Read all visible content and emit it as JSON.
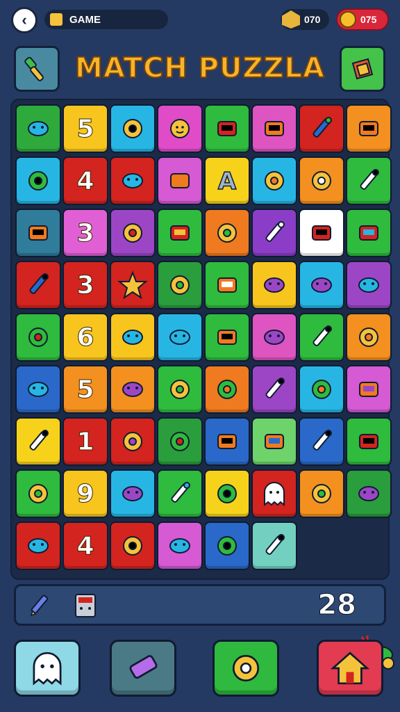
{
  "topbar": {
    "back_icon": "chevron-left-icon",
    "game_label": "GAME",
    "coins": "070",
    "lives": "075"
  },
  "title": "MATCH PUZZLA",
  "board": {
    "rows": 9,
    "cols": 8,
    "tiles": [
      {
        "color": "#2eaa3c",
        "icon": "creature-icon"
      },
      {
        "color": "#f7c51d",
        "num": "5"
      },
      {
        "color": "#27b6e4",
        "icon": "device-icon"
      },
      {
        "color": "#e04bc8",
        "icon": "sun-face-icon"
      },
      {
        "color": "#2fbb3d",
        "icon": "pencil-icon"
      },
      {
        "color": "#de55c2",
        "icon": "bird-icon"
      },
      {
        "color": "#d3241f",
        "icon": "gears-icon"
      },
      {
        "color": "#f3901f",
        "icon": "target-icon"
      },
      {
        "color": "#27b6e4",
        "icon": "robot-icon"
      },
      {
        "color": "#d3241f",
        "num": "4"
      },
      {
        "color": "#d3241f",
        "icon": "crown-icon"
      },
      {
        "color": "#d55ad3",
        "icon": "pen-icon"
      },
      {
        "color": "#f7d21b",
        "icon": "letter-a-icon"
      },
      {
        "color": "#27b6e4",
        "icon": "magnifier-icon"
      },
      {
        "color": "#f3901f",
        "icon": "gear-icon"
      },
      {
        "color": "#2fbb3d",
        "icon": "search-icon"
      },
      {
        "color": "#2f7d9b",
        "icon": "shield-icon"
      },
      {
        "color": "#e15fd4",
        "num": "3"
      },
      {
        "color": "#9c46c6",
        "icon": "leaf-icon"
      },
      {
        "color": "#2fbb3d",
        "icon": "egg-icon"
      },
      {
        "color": "#f07a1f",
        "icon": "crayon-icon"
      },
      {
        "color": "#8b3dc8",
        "icon": "ring-icon"
      },
      {
        "color": "#ffffff",
        "icon": "pencil-icon"
      },
      {
        "color": "#2fbb3d",
        "icon": "trowel-icon"
      },
      {
        "color": "#d3241f",
        "icon": "heart-badge-icon"
      },
      {
        "color": "#d3241f",
        "num": "3"
      },
      {
        "color": "#d3241f",
        "icon": "star-icon"
      },
      {
        "color": "#2a9d3c",
        "icon": "bottle-icon"
      },
      {
        "color": "#2fbb3d",
        "icon": "spoon-icon"
      },
      {
        "color": "#f7c51d",
        "icon": "bell-icon"
      },
      {
        "color": "#27b6e4",
        "icon": "toolbox-icon"
      },
      {
        "color": "#9c46c6",
        "icon": "cherries-icon"
      },
      {
        "color": "#2fbb3d",
        "icon": "monitor-icon"
      },
      {
        "color": "#f7c51d",
        "num": "6"
      },
      {
        "color": "#f7c51d",
        "icon": "cheese-icon"
      },
      {
        "color": "#27b6e4",
        "icon": "balloon-icon"
      },
      {
        "color": "#2fbb3d",
        "icon": "germ-icon"
      },
      {
        "color": "#de55c2",
        "icon": "sheep-icon"
      },
      {
        "color": "#2fbb3d",
        "icon": "planet-icon"
      },
      {
        "color": "#f3901f",
        "icon": "lens-icon"
      },
      {
        "color": "#2a69c9",
        "icon": "key-icon"
      },
      {
        "color": "#f3901f",
        "num": "5"
      },
      {
        "color": "#f3901f",
        "icon": "box-icon"
      },
      {
        "color": "#2fbb3d",
        "icon": "hammer-icon"
      },
      {
        "color": "#f07a1f",
        "icon": "brush-icon"
      },
      {
        "color": "#9c46c6",
        "icon": "ladle-icon"
      },
      {
        "color": "#27b6e4",
        "icon": "marker-icon"
      },
      {
        "color": "#d55ad3",
        "icon": "wrench-icon"
      },
      {
        "color": "#f7d21b",
        "icon": "card-icon"
      },
      {
        "color": "#d3241f",
        "num": "1"
      },
      {
        "color": "#d3241f",
        "icon": "cross-tools-icon"
      },
      {
        "color": "#2a9d3c",
        "icon": "pickle-icon"
      },
      {
        "color": "#2a69c9",
        "icon": "spiral-icon"
      },
      {
        "color": "#6dd36a",
        "icon": "smile-bubble-icon"
      },
      {
        "color": "#2a69c9",
        "icon": "castle-icon"
      },
      {
        "color": "#2fbb3d",
        "icon": "virus-icon"
      },
      {
        "color": "#2fbb3d",
        "icon": "hammer-icon"
      },
      {
        "color": "#f7c51d",
        "num": "9"
      },
      {
        "color": "#27b6e4",
        "icon": "radio-icon"
      },
      {
        "color": "#2fbb3d",
        "icon": "rattle-icon"
      },
      {
        "color": "#f7d21b",
        "icon": "tv-icon"
      },
      {
        "color": "#d3241f",
        "icon": "ghost-icon"
      },
      {
        "color": "#f3901f",
        "icon": "crayon-icon"
      },
      {
        "color": "#2a9d3c",
        "icon": "drop-face-icon"
      },
      {
        "color": "#d3241f",
        "icon": "machine-icon"
      },
      {
        "color": "#d3241f",
        "num": "4"
      },
      {
        "color": "#d3241f",
        "icon": "table-icon"
      },
      {
        "color": "#d55ad3",
        "icon": "cherries-icon"
      },
      {
        "color": "#2a69c9",
        "icon": "cloth-icon"
      },
      {
        "color": "#73d0c0",
        "icon": "speech-face-icon"
      }
    ]
  },
  "corner_icon": "dinosaur-icon",
  "tray": {
    "tool1_icon": "pencil-icon",
    "tool2_icon": "calculator-icon",
    "score": "28"
  },
  "bottom": [
    {
      "name": "ghost-button",
      "icon": "ghost-icon",
      "color": "#8fd8e6"
    },
    {
      "name": "eraser-button",
      "icon": "eraser-icon",
      "color": "#4a7a86"
    },
    {
      "name": "settings-button",
      "icon": "gear-icon",
      "color": "#2fb93f"
    },
    {
      "name": "home-button",
      "icon": "home-icon",
      "color": "#e23b52"
    }
  ]
}
